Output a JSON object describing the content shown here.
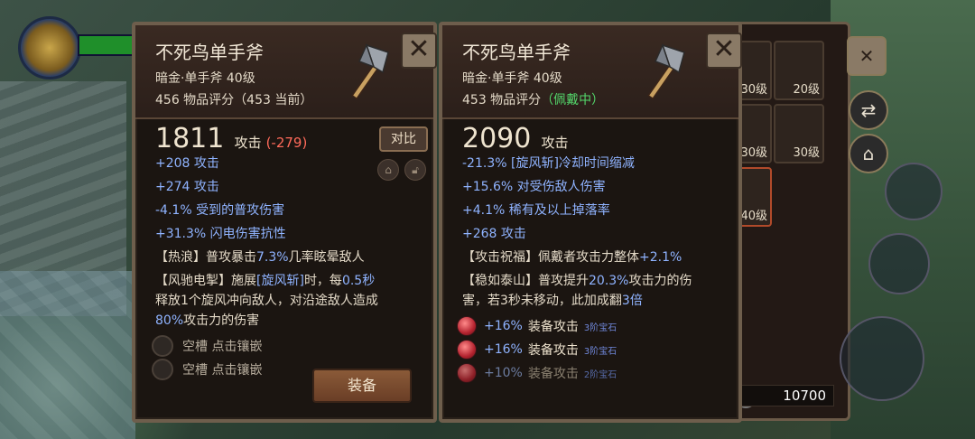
{
  "left": {
    "name": "不死鸟单手斧",
    "subtitle": "暗金·单手斧 40级",
    "score_text": "456 物品评分（453 当前）",
    "attack_value": "1811",
    "attack_label": "攻击",
    "attack_diff": "(-279)",
    "compare_label": "对比",
    "stats": [
      "+208 攻击",
      "+274 攻击",
      "-4.1% 受到的普攻伤害",
      "+31.3% 闪电伤害抗性"
    ],
    "affix1_prefix": "【热浪】普攻暴击",
    "affix1_hl": "7.3%",
    "affix1_suffix": "几率眩晕敌人",
    "affix2_line1_a": "【风驰电掣】施展",
    "affix2_line1_hl": "[旋风斩]",
    "affix2_line1_b": "时，每",
    "affix2_line1_hl2": "0.5秒",
    "affix2_line2": "释放1个旋风冲向敌人，对沿途敌人造成",
    "affix2_line3_hl": "80%",
    "affix2_line3_b": "攻击力的伤害",
    "sockets": [
      "空槽 点击镶嵌",
      "空槽 点击镶嵌"
    ],
    "equip_label": "装备"
  },
  "right": {
    "name": "不死鸟单手斧",
    "subtitle": "暗金·单手斧 40级",
    "score_text": "453 物品评分",
    "score_equipped": "（佩戴中）",
    "attack_value": "2090",
    "attack_label": "攻击",
    "stats": [
      "-21.3% [旋风斩]冷却时间缩减",
      "+15.6% 对受伤敌人伤害",
      "+4.1% 稀有及以上掉落率",
      "+268 攻击"
    ],
    "affix1_prefix": "【攻击祝福】佩戴者攻击力整体",
    "affix1_hl": "+2.1%",
    "affix2_line1_a": "【稳如泰山】普攻提升",
    "affix2_line1_hl": "20.3%",
    "affix2_line1_b": "攻击力的伤",
    "affix2_line2_a": "害，若3秒未移动，此加成翻",
    "affix2_line2_hl": "3倍",
    "gems": [
      {
        "value": "+16%",
        "label": "装备攻击",
        "tier": "3阶宝石"
      },
      {
        "value": "+16%",
        "label": "装备攻击",
        "tier": "3阶宝石"
      },
      {
        "value": "+10%",
        "label": "装备攻击",
        "tier": "2阶宝石"
      }
    ]
  },
  "bag": {
    "slot_levels": [
      "30级",
      "20级",
      "30级",
      "30级",
      "40级"
    ],
    "coins": "10700"
  }
}
